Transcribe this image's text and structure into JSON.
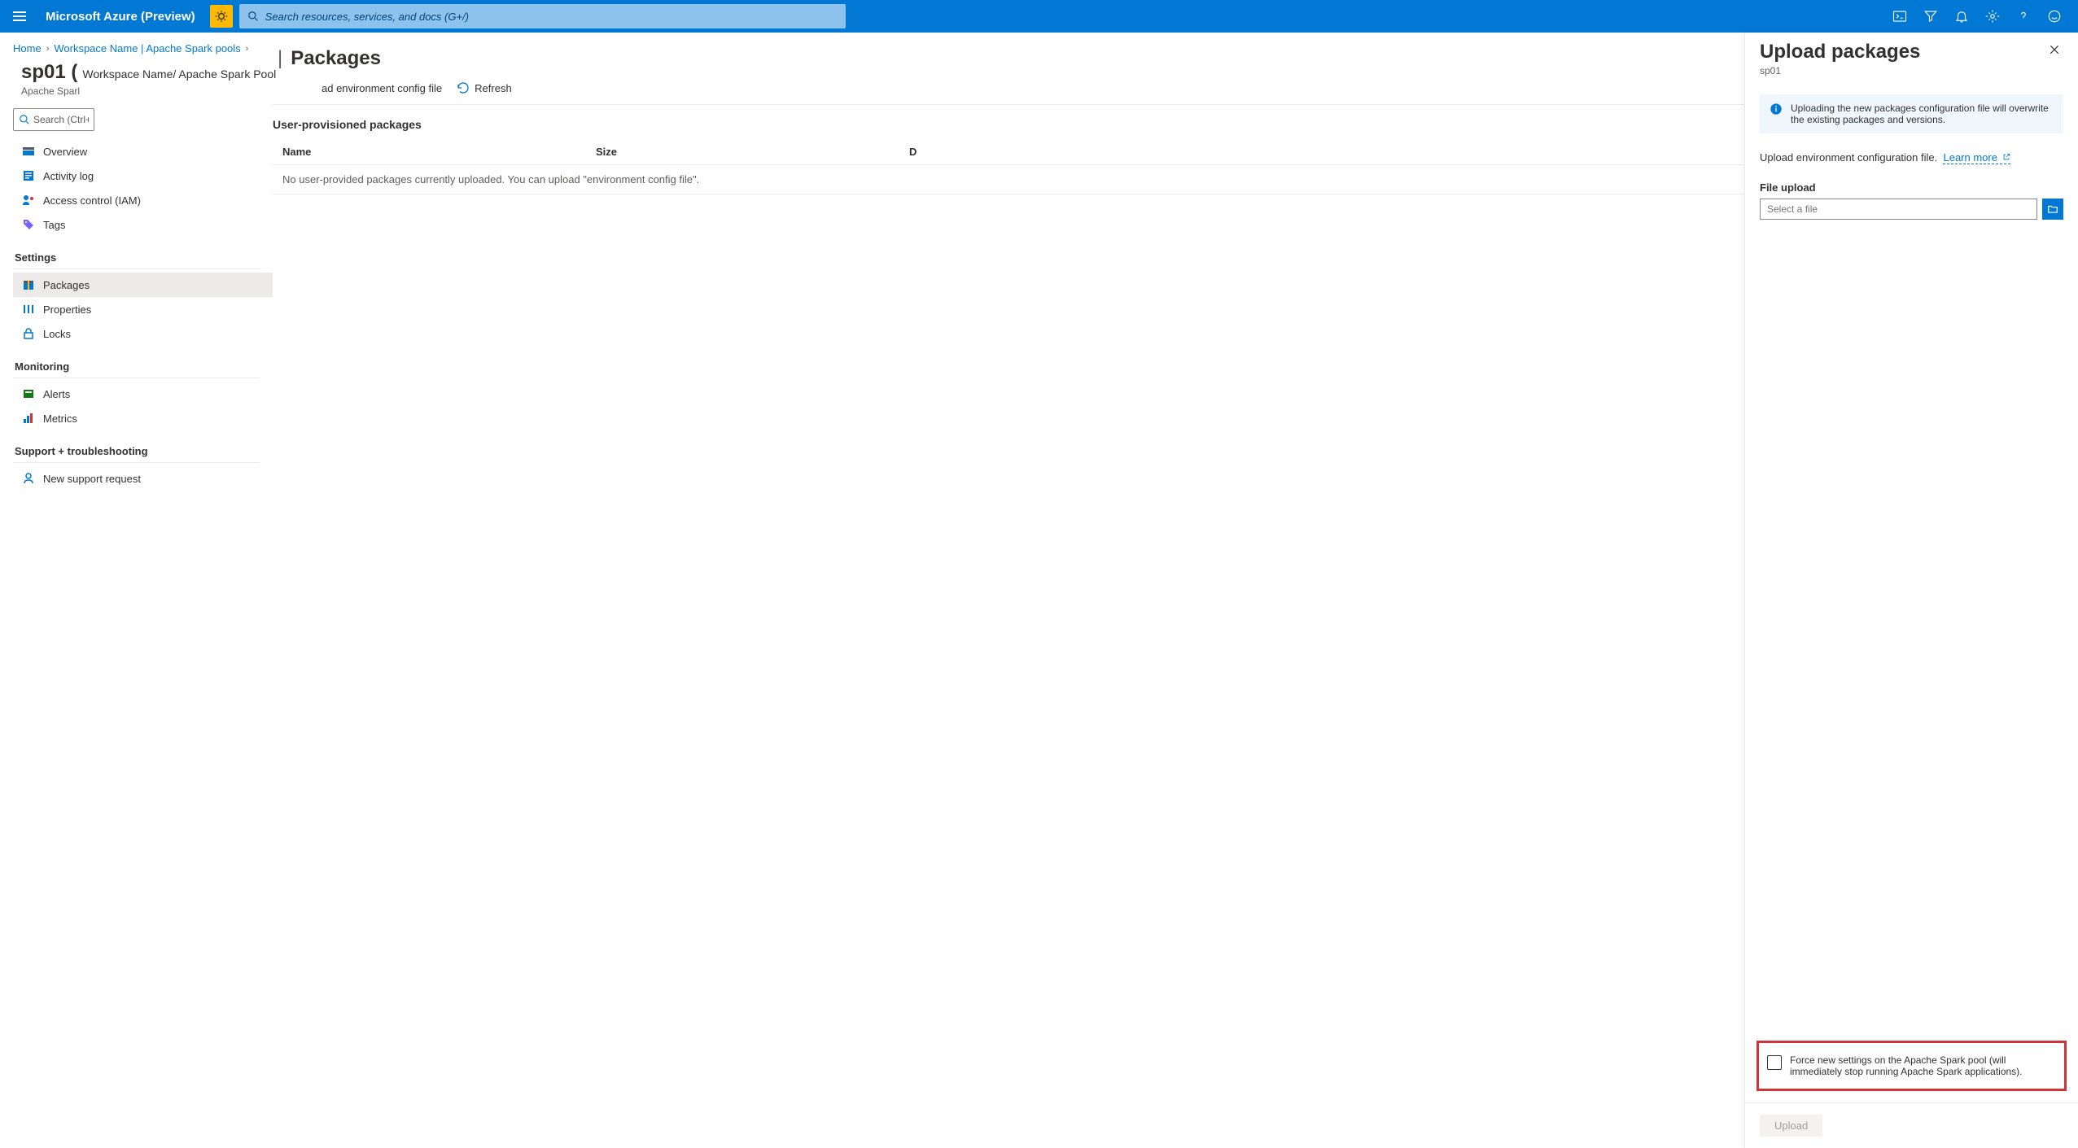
{
  "header": {
    "brand": "Microsoft Azure (Preview)",
    "search_placeholder": "Search resources, services, and docs (G+/)"
  },
  "breadcrumb": {
    "home": "Home",
    "workspace": "Workspace Name | Apache Spark pools"
  },
  "resource": {
    "name": "sp01 (",
    "path": "Workspace Name/ Apache Spark Pool",
    "subtitle": "Apache Sparl"
  },
  "nav_search_placeholder": "Search (Ctrl+/)",
  "nav": {
    "overview": "Overview",
    "activity_log": "Activity log",
    "access": "Access control (IAM)",
    "tags": "Tags",
    "section_settings": "Settings",
    "packages": "Packages",
    "properties": "Properties",
    "locks": "Locks",
    "section_monitoring": "Monitoring",
    "alerts": "Alerts",
    "metrics": "Metrics",
    "section_support": "Support + troubleshooting",
    "new_support": "New support request"
  },
  "content": {
    "title_pipe": "|",
    "title": "Packages",
    "toolbar_upload": "ad environment config file",
    "toolbar_refresh": "Refresh",
    "section_heading": "User-provisioned packages",
    "col_name": "Name",
    "col_size": "Size",
    "col_date_partial": "D",
    "empty_msg": "No user-provided packages currently uploaded. You can upload \"environment config file\"."
  },
  "flyout": {
    "title": "Upload packages",
    "subtitle": "sp01",
    "info": "Uploading the new packages configuration file will overwrite the existing packages and versions.",
    "instruct": "Upload environment configuration file.",
    "learn_more": "Learn more",
    "file_label": "File upload",
    "file_placeholder": "Select a file",
    "force_label": "Force new settings on the Apache Spark pool (will immediately stop running Apache Spark applications).",
    "upload_btn": "Upload"
  }
}
